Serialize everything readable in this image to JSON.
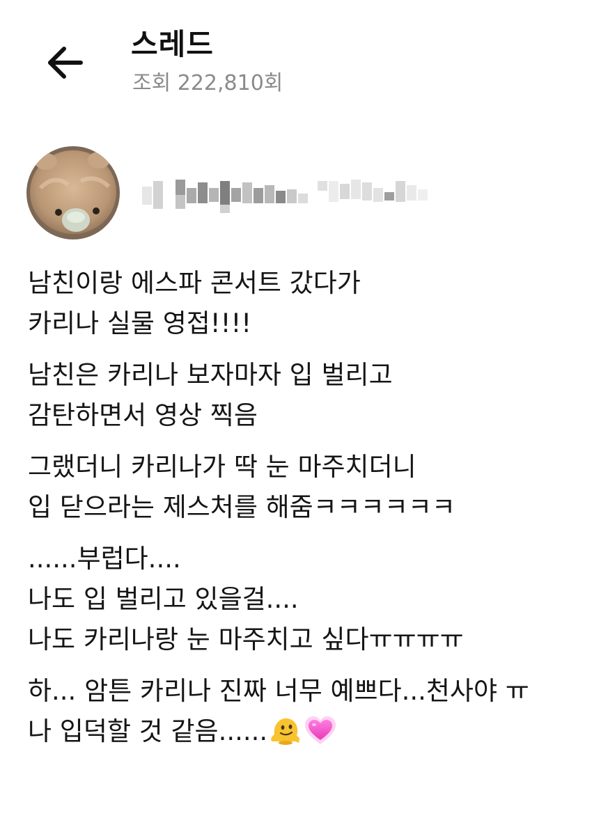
{
  "header": {
    "back_icon": "arrow-left-icon",
    "title": "스레드",
    "views": "조회 222,810회"
  },
  "author": {
    "avatar_icon": "teddy-bear-avatar",
    "username_blurred": true
  },
  "post": {
    "paragraphs": [
      {
        "lines": [
          "남친이랑 에스파 콘서트 갔다가",
          "카리나 실물 영접!!!!"
        ]
      },
      {
        "lines": [
          "남친은 카리나 보자마자 입 벌리고",
          "감탄하면서 영상 찍음"
        ]
      },
      {
        "lines": [
          "그랬더니 카리나가 딱 눈 마주치더니",
          "입 닫으라는 제스처를 해줌ㅋㅋㅋㅋㅋㅋ"
        ]
      },
      {
        "lines": [
          "......부럽다....",
          "나도 입 벌리고 있을걸....",
          "나도 카리나랑 눈 마주치고 싶다ㅠㅠㅠㅠ"
        ]
      },
      {
        "lines": [
          "하... 암튼 카리나 진짜 너무 예쁘다...천사야 ㅠ",
          "나 입덕할 것 같음......"
        ]
      }
    ],
    "trailing_emojis": [
      "melting-face-emoji",
      "growing-heart-emoji"
    ]
  },
  "colors": {
    "text": "#151515",
    "muted": "#8a8a8a",
    "background": "#ffffff"
  }
}
